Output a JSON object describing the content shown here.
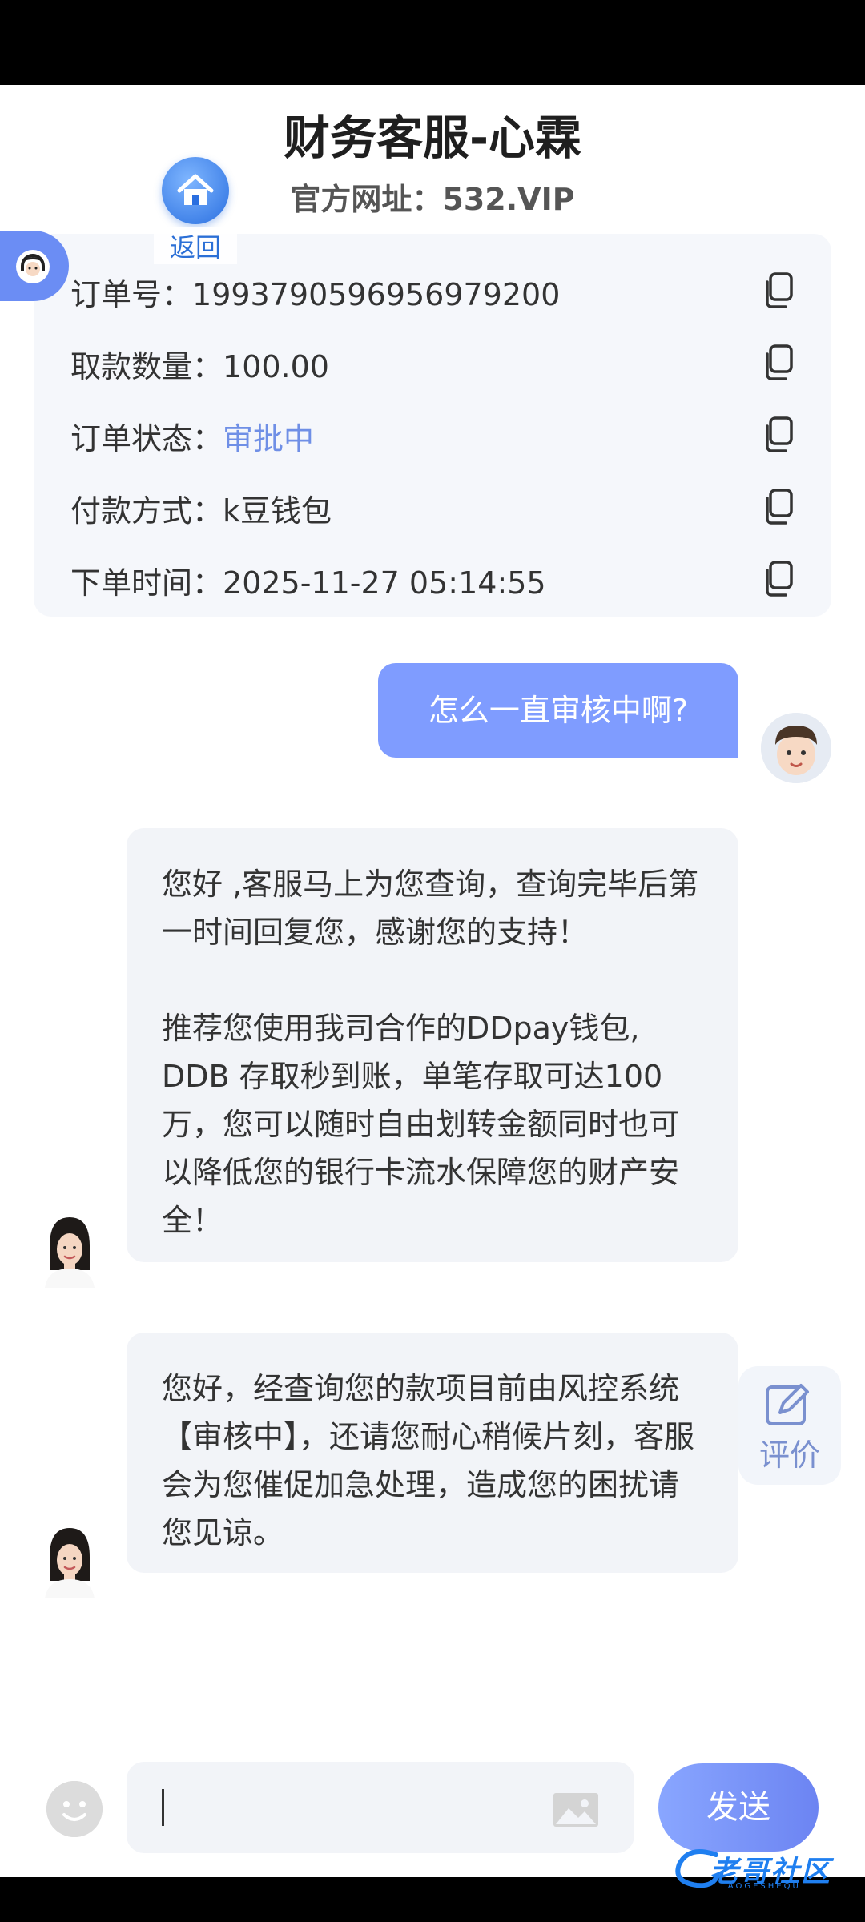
{
  "header": {
    "title": "财务客服-心霖",
    "subtitle": "官方网址：532.VIP",
    "back_label": "返回"
  },
  "order": {
    "rows": [
      {
        "label": "订单号：",
        "value": "1993790596956979200"
      },
      {
        "label": "取款数量：",
        "value": "100.00"
      },
      {
        "label": "订单状态：",
        "value": "审批中"
      },
      {
        "label": "付款方式：",
        "value": "k豆钱包"
      },
      {
        "label": "下单时间：",
        "value": "2025-11-27 05:14:55"
      }
    ]
  },
  "messages": {
    "user_1": "怎么一直审核中啊?",
    "agent_1_p1": "您好 ,客服马上为您查询，查询完毕后第一时间回复您，感谢您的支持！",
    "agent_1_p2": "推荐您使用我司合作的DDpay钱包, DDB 存取秒到账，单笔存取可达100万，您可以随时自由划转金额同时也可以降低您的银行卡流水保障您的财产安全！",
    "agent_2": "您好，经查询您的款项目前由风控系统【审核中】，还请您耐心稍候片刻，客服会为您催促加急处理，造成您的困扰请您见谅。"
  },
  "rate_label": "评价",
  "composer": {
    "input_value": "",
    "send_label": "发送"
  },
  "watermark": {
    "text": "老哥社区",
    "sub": "LAOGESHEQU"
  },
  "colors": {
    "accent": "#7f9cff",
    "status_blue": "#6f8fe6",
    "card_bg": "#f5f7fb"
  }
}
